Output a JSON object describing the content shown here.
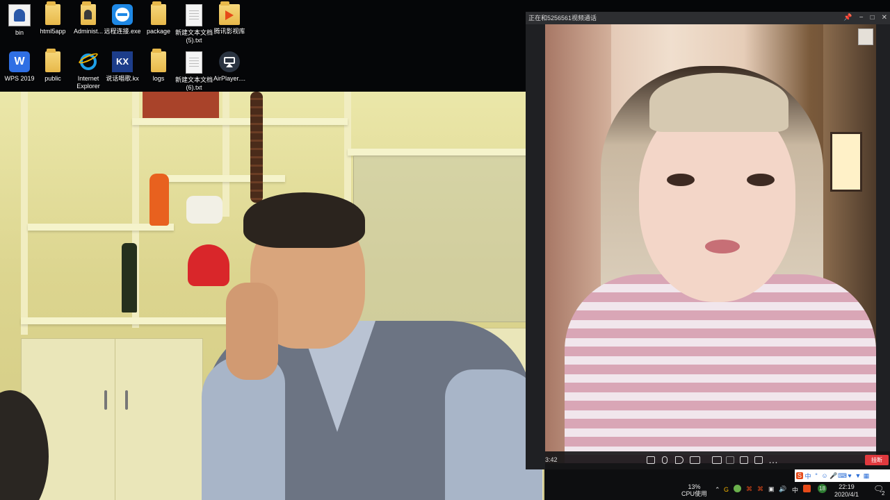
{
  "desktop": {
    "icons": [
      {
        "label": "bin",
        "icon": "user-folder-icon"
      },
      {
        "label": "html5app",
        "icon": "folder-icon"
      },
      {
        "label": "Administ...",
        "icon": "user-folder-icon"
      },
      {
        "label": "远程连接.exe",
        "icon": "teamviewer-icon"
      },
      {
        "label": "package",
        "icon": "folder-icon"
      },
      {
        "label": "新建文本文档\n(5).txt",
        "icon": "text-file-icon"
      },
      {
        "label": "腾讯影视库",
        "icon": "video-folder-icon"
      },
      {
        "label": "WPS 2019",
        "icon": "wps-icon"
      },
      {
        "label": "public",
        "icon": "folder-icon"
      },
      {
        "label": "Internet\nExplorer",
        "icon": "ie-icon"
      },
      {
        "label": "说话唱歌.kx",
        "icon": "kx-icon"
      },
      {
        "label": "logs",
        "icon": "folder-icon"
      },
      {
        "label": "新建文本文档\n(6).txt",
        "icon": "text-file-icon"
      },
      {
        "label": "AirPlayer....",
        "icon": "airplay-icon"
      }
    ]
  },
  "call": {
    "title": "正在和5256561视频通话",
    "elapsed": "3:42",
    "hangup_label": "挂断",
    "controls": [
      "chat-icon",
      "microphone-icon",
      "speaker-icon",
      "camera-off-icon",
      "snapshot-icon",
      "record-icon",
      "layout-icon",
      "share-icon",
      "more-icon"
    ],
    "window_controls": [
      "pin-icon",
      "minimize-icon",
      "maximize-icon",
      "close-icon"
    ]
  },
  "taskbar": {
    "cpu_percent": "13%",
    "cpu_label": "CPU使用",
    "ime_label": "中",
    "clock_time": "22:19",
    "clock_date": "2020/4/1",
    "notification_count": "2",
    "badge_count": "18"
  },
  "colors": {
    "hangup": "#e0393e",
    "call_bg": "#1f2023",
    "taskbar_bg": "#0d0e10"
  }
}
